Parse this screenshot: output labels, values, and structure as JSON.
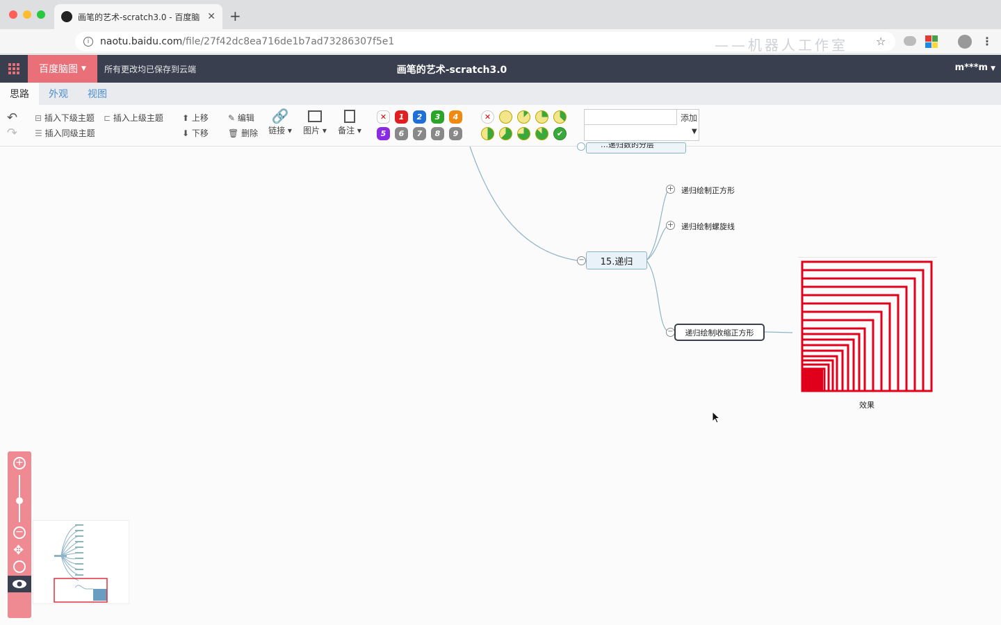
{
  "browser": {
    "tab_title": "画笔的艺术-scratch3.0 - 百度脑",
    "url_host": "naotu.baidu.com",
    "url_path": "/file/27f42dc8ea716de1b7ad73286307f5e1",
    "watermark": "——机器人工作室"
  },
  "header": {
    "brand": "百度脑图",
    "save_status": "所有更改均已保存到云端",
    "doc_title": "画笔的艺术-scratch3.0",
    "user": "m***m"
  },
  "tabs": [
    {
      "label": "思路"
    },
    {
      "label": "外观"
    },
    {
      "label": "视图"
    }
  ],
  "toolbar": {
    "insert_child": "插入下级主题",
    "insert_parent": "插入上级主题",
    "insert_sibling": "插入同级主题",
    "move_up": "上移",
    "move_down": "下移",
    "edit": "编辑",
    "delete": "删除",
    "link": "链接",
    "image": "图片",
    "note": "备注",
    "add": "添加",
    "priorities": [
      "1",
      "2",
      "3",
      "4",
      "5",
      "6",
      "7",
      "8",
      "9"
    ]
  },
  "colors": {
    "header_bg": "#393f4f",
    "brand_bg": "#e96f78",
    "link_blue": "#4c8ed1",
    "square_red": "#e0001b"
  },
  "canvas": {
    "top_partial": "…递归数的分层",
    "main_node": "15.递归",
    "child1": "递归绘制正方形",
    "child2": "递归绘制螺旋线",
    "child3": "递归绘制收缩正方形",
    "image_caption": "效果"
  }
}
